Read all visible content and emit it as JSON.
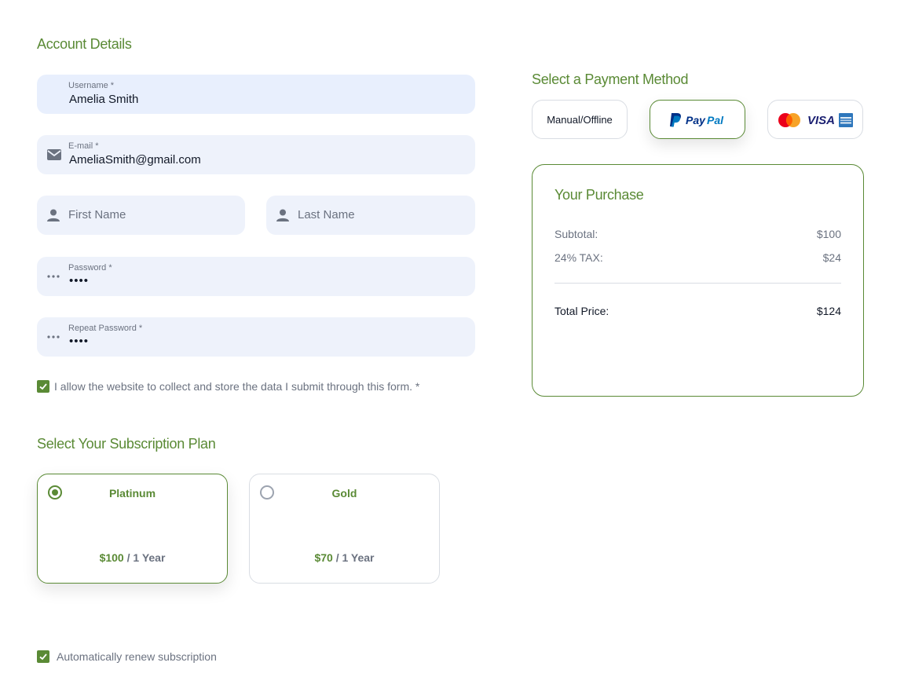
{
  "account": {
    "title": "Account Details",
    "username": {
      "label": "Username *",
      "value": "Amelia Smith"
    },
    "email": {
      "label": "E-mail *",
      "value": "AmeliaSmith@gmail.com"
    },
    "first_name": {
      "placeholder": "First Name"
    },
    "last_name": {
      "placeholder": "Last Name"
    },
    "password": {
      "label": "Password *",
      "value": "••••"
    },
    "repeat_password": {
      "label": "Repeat Password *",
      "value": "••••"
    },
    "consent": {
      "label": "I allow the website to collect and store the data I submit through this form. *",
      "checked": true
    }
  },
  "subscription": {
    "title": "Select Your Subscription Plan",
    "plans": [
      {
        "name": "Platinum",
        "price": "$100",
        "period": " / 1 Year",
        "selected": true
      },
      {
        "name": "Gold",
        "price": "$70",
        "period": " / 1 Year",
        "selected": false
      }
    ],
    "auto_renew": {
      "label": "Automatically renew subscription",
      "checked": true
    }
  },
  "payment": {
    "title": "Select a Payment Method",
    "methods": [
      {
        "label": "Manual/Offline",
        "selected": false
      },
      {
        "label": "PayPal",
        "selected": true
      },
      {
        "label": "VISA",
        "selected": false
      }
    ]
  },
  "purchase": {
    "title": "Your Purchase",
    "subtotal_label": "Subtotal:",
    "subtotal_value": "$100",
    "tax_label": "24% TAX:",
    "tax_value": "$24",
    "total_label": "Total Price:",
    "total_value": "$124"
  },
  "colors": {
    "accent": "#5a8a35",
    "field_bg": "#eef2fb",
    "border": "#d9dde3"
  }
}
